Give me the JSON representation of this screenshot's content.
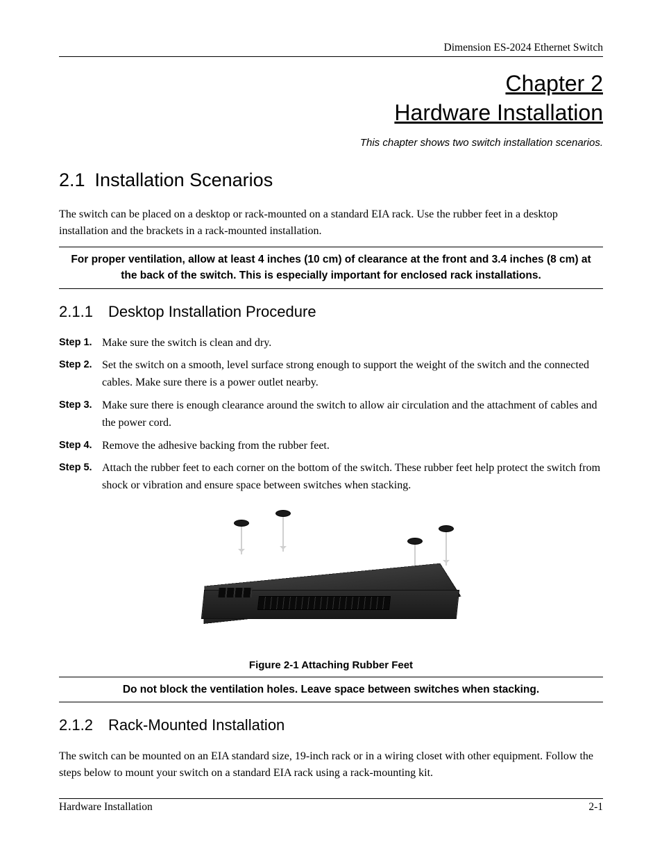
{
  "header": {
    "product": "Dimension ES-2024 Ethernet Switch"
  },
  "chapter": {
    "label": "Chapter 2",
    "title": "Hardware Installation",
    "subtitle": "This chapter shows two switch installation scenarios."
  },
  "section_2_1": {
    "num": "2.1",
    "title": "Installation Scenarios",
    "body": "The switch can be placed on a desktop or rack-mounted on a standard EIA rack. Use the rubber feet in a desktop installation and the brackets in a rack-mounted installation.",
    "warning": "For proper ventilation, allow at least 4 inches (10 cm) of clearance at the front and 3.4 inches (8 cm) at the back of the switch. This is especially important for enclosed rack installations."
  },
  "section_2_1_1": {
    "num": "2.1.1",
    "title": "Desktop Installation Procedure",
    "steps": [
      {
        "label": "Step 1.",
        "text": "Make sure the switch is clean and dry."
      },
      {
        "label": "Step 2.",
        "text": "Set the switch on a smooth, level surface strong enough to support the weight of the switch and the connected cables. Make sure there is a power outlet nearby."
      },
      {
        "label": "Step 3.",
        "text": "Make sure there is enough clearance around the switch to allow air circulation and the attachment of cables and the power cord."
      },
      {
        "label": "Step 4.",
        "text": "Remove the adhesive backing from the rubber feet."
      },
      {
        "label": "Step 5.",
        "text": "Attach the rubber feet to each corner on the bottom of the switch. These rubber feet help protect the switch from shock or vibration and ensure space between switches when stacking."
      }
    ],
    "figure_caption": "Figure 2-1 Attaching Rubber Feet",
    "warning2": "Do not block the ventilation holes. Leave space between switches when stacking."
  },
  "section_2_1_2": {
    "num": "2.1.2",
    "title": "Rack-Mounted Installation",
    "body": "The switch can be mounted on an EIA standard size, 19-inch rack or in a wiring closet with other equipment. Follow the steps below to mount your switch on a standard EIA rack using a rack-mounting kit."
  },
  "footer": {
    "left": "Hardware Installation",
    "right": "2-1"
  }
}
